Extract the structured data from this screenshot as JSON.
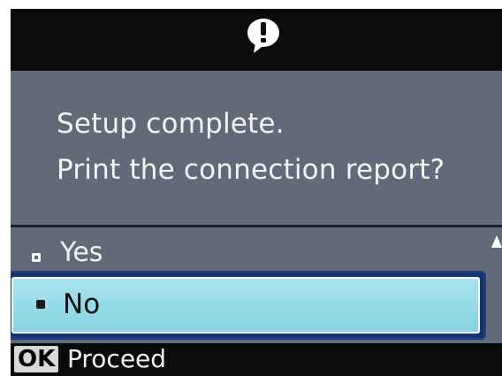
{
  "header": {
    "icon": "info-speech-bubble-icon"
  },
  "message": {
    "line1": "Setup complete.",
    "line2": "Print the connection report?"
  },
  "options": [
    {
      "label": "Yes",
      "selected": false
    },
    {
      "label": "No",
      "selected": true
    }
  ],
  "footer": {
    "key_label": "OK",
    "action_label": "Proceed"
  },
  "colors": {
    "header_bg": "#0b0b0d",
    "screen_bg": "#616a79",
    "selection_bg": "#84d3e3",
    "selection_border": "#12336f"
  }
}
